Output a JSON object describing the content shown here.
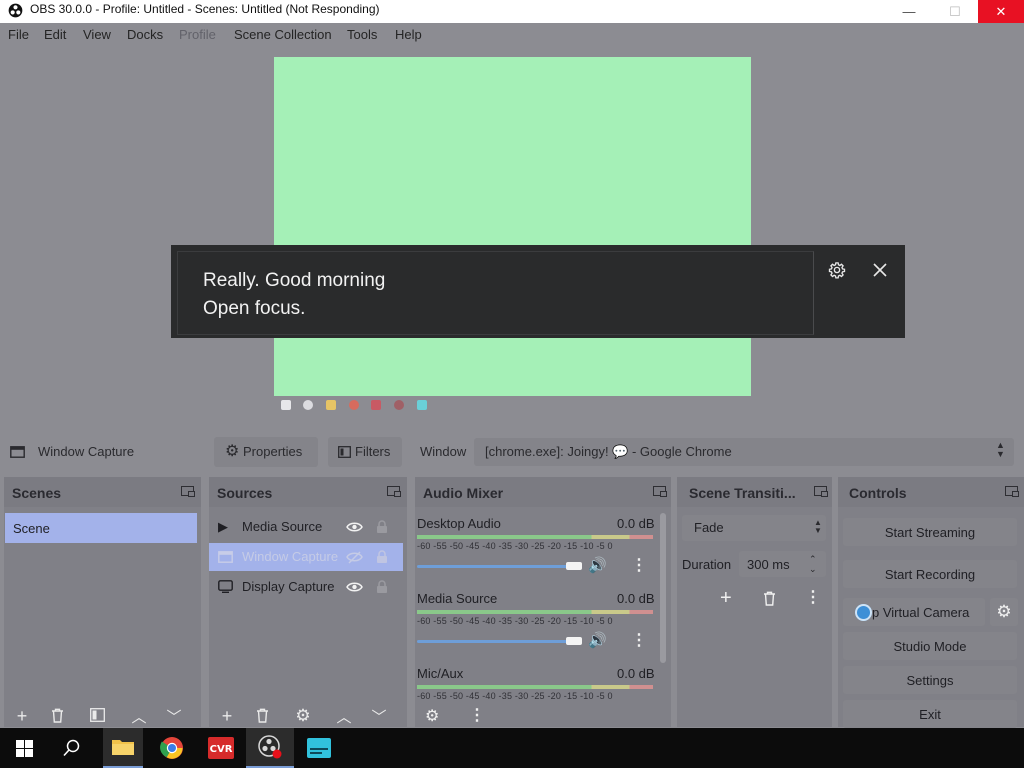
{
  "window": {
    "title": "OBS 30.0.0 - Profile: Untitled - Scenes: Untitled (Not Responding)",
    "min_glyph": "—",
    "max_glyph": "☐",
    "close_glyph": "✕"
  },
  "menu": [
    "File",
    "Edit",
    "View",
    "Docks",
    "Profile",
    "Scene Collection",
    "Tools",
    "Help"
  ],
  "caption": {
    "line1": "Really. Good morning",
    "line2": "Open focus."
  },
  "toolbar": {
    "source_name": "Window Capture",
    "properties_label": "Properties",
    "filters_label": "Filters",
    "window_label": "Window",
    "window_value": "[chrome.exe]: Joingy! 💬 - Google Chrome"
  },
  "scenes": {
    "title": "Scenes",
    "items": [
      "Scene"
    ]
  },
  "sources": {
    "title": "Sources",
    "items": [
      {
        "name": "Media Source",
        "icon": "play-icon"
      },
      {
        "name": "Window Capture",
        "icon": "window-icon"
      },
      {
        "name": "Display Capture",
        "icon": "monitor-icon"
      }
    ]
  },
  "audio_mixer": {
    "title": "Audio Mixer",
    "scale": "-60 -55 -50 -45 -40 -35 -30 -25 -20 -15 -10 -5 0",
    "channels": [
      {
        "name": "Desktop Audio",
        "level": "0.0 dB",
        "volume": 0.97
      },
      {
        "name": "Media Source",
        "level": "0.0 dB",
        "volume": 0.97
      },
      {
        "name": "Mic/Aux",
        "level": "0.0 dB",
        "volume": 0.97
      }
    ]
  },
  "transitions": {
    "title": "Scene Transiti...",
    "type": "Fade",
    "duration_label": "Duration",
    "duration_value": "300 ms"
  },
  "controls": {
    "title": "Controls",
    "start_streaming": "Start Streaming",
    "start_recording": "Start Recording",
    "virtual_camera": "p Virtual Camera",
    "studio_mode": "Studio Mode",
    "settings": "Settings",
    "exit": "Exit"
  },
  "colors": {
    "preview": "#a5f0b7",
    "selected": "#a3b2ea",
    "close_red": "#e81123"
  }
}
